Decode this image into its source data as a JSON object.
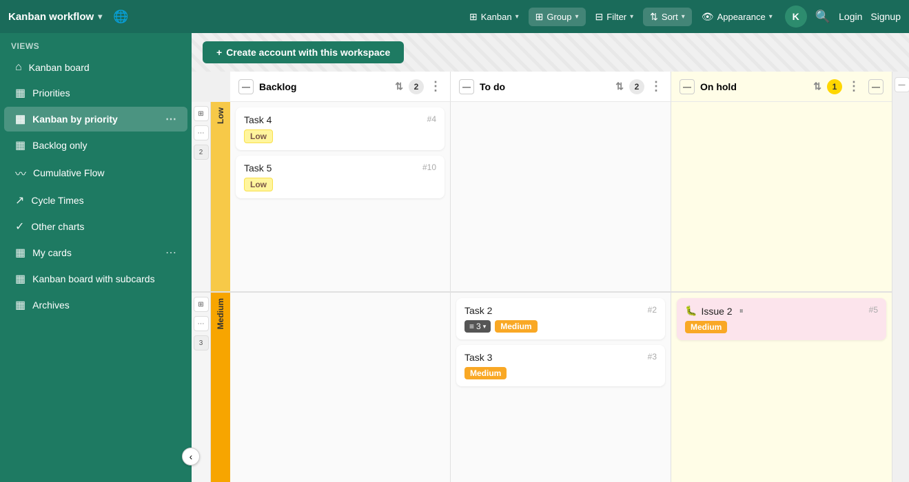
{
  "app": {
    "title": "Kanban workflow",
    "globe_icon": "🌐"
  },
  "topnav": {
    "kanban_label": "Kanban",
    "group_label": "Group",
    "filter_label": "Filter",
    "sort_label": "Sort",
    "appearance_label": "Appearance",
    "avatar_letter": "K",
    "login_label": "Login",
    "signup_label": "Signup"
  },
  "sidebar": {
    "views_label": "Views",
    "items": [
      {
        "id": "kanban-board",
        "label": "Kanban board",
        "icon": "⌂"
      },
      {
        "id": "priorities",
        "label": "Priorities",
        "icon": "▦"
      },
      {
        "id": "kanban-by-priority",
        "label": "Kanban by priority",
        "icon": "▦",
        "active": true
      },
      {
        "id": "backlog-only",
        "label": "Backlog only",
        "icon": "▦"
      },
      {
        "id": "cumulative-flow",
        "label": "Cumulative Flow",
        "icon": "~"
      },
      {
        "id": "cycle-times",
        "label": "Cycle Times",
        "icon": "↗"
      },
      {
        "id": "other-charts",
        "label": "Other charts",
        "icon": "✓"
      },
      {
        "id": "my-cards",
        "label": "My cards",
        "icon": "▦"
      },
      {
        "id": "kanban-subcards",
        "label": "Kanban board with subcards",
        "icon": "▦"
      },
      {
        "id": "archives",
        "label": "Archives",
        "icon": "▦"
      }
    ]
  },
  "create_account": {
    "button_label": "Create account with this workspace"
  },
  "columns": [
    {
      "id": "backlog",
      "title": "Backlog",
      "count": "2",
      "is_on_hold": false
    },
    {
      "id": "todo",
      "title": "To do",
      "count": "2",
      "is_on_hold": false
    },
    {
      "id": "on-hold",
      "title": "On hold",
      "count": "1",
      "is_on_hold": true
    }
  ],
  "swimlanes": [
    {
      "id": "low",
      "label": "Low",
      "cards": {
        "backlog": [
          {
            "id": "task4",
            "title": "Task 4",
            "number": "#4",
            "tags": [
              {
                "label": "Low",
                "type": "low"
              }
            ]
          },
          {
            "id": "task5",
            "title": "Task 5",
            "number": "#10",
            "tags": [
              {
                "label": "Low",
                "type": "low"
              }
            ]
          }
        ],
        "todo": [],
        "on-hold": []
      }
    },
    {
      "id": "medium",
      "label": "Medium",
      "cards": {
        "backlog": [],
        "todo": [
          {
            "id": "task2",
            "title": "Task 2",
            "number": "#2",
            "subtasks": "3",
            "tags": [
              {
                "label": "Medium",
                "type": "medium"
              }
            ]
          },
          {
            "id": "task3",
            "title": "Task 3",
            "number": "#3",
            "tags": [
              {
                "label": "Medium",
                "type": "medium"
              }
            ]
          }
        ],
        "on-hold": [
          {
            "id": "issue2",
            "title": "Issue 2",
            "number": "#5",
            "tags": [
              {
                "label": "Medium",
                "type": "medium"
              }
            ],
            "has_pause": true,
            "is_pink": true,
            "has_bug": true
          }
        ]
      }
    }
  ]
}
